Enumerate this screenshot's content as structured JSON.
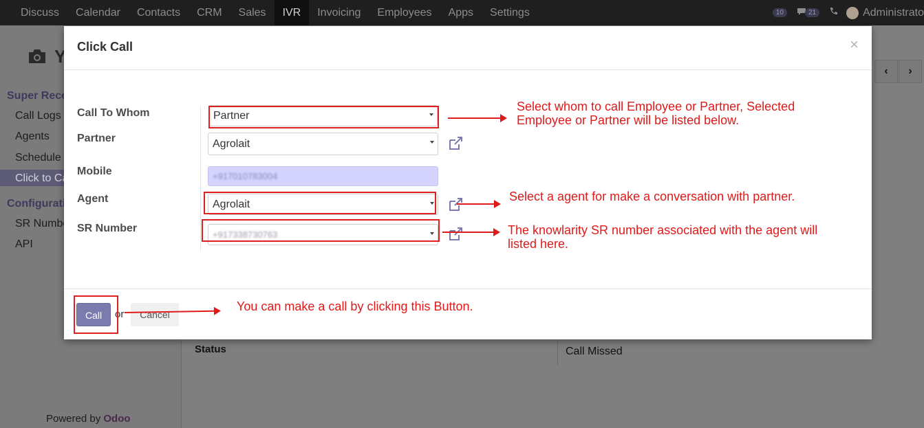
{
  "nav": {
    "items": [
      "Discuss",
      "Calendar",
      "Contacts",
      "CRM",
      "Sales",
      "IVR",
      "Invoicing",
      "Employees",
      "Apps",
      "Settings"
    ],
    "active": "IVR",
    "badge_activity": "10",
    "badge_messages": "21",
    "user": "Administrato"
  },
  "sidebar": {
    "section1": "Super Rece",
    "items1": [
      "Call Logs",
      "Agents",
      "Schedule",
      "Click to Ca"
    ],
    "active_item": "Click to Ca",
    "section2": "Configurati",
    "items2": [
      "SR Number",
      "API"
    ],
    "powered_prefix": "Powered by",
    "powered_brand": "Odoo"
  },
  "background": {
    "breadcrumb_fragment": "Y",
    "status_label": "Status",
    "status_value": "Call Missed"
  },
  "modal": {
    "title": "Click Call",
    "close": "×",
    "fields": {
      "call_to_whom_label": "Call To Whom",
      "call_to_whom_value": "Partner",
      "partner_label": "Partner",
      "partner_value": "Agrolait",
      "mobile_label": "Mobile",
      "mobile_value": "+917010783004",
      "agent_label": "Agent",
      "agent_value": "Agrolait",
      "sr_number_label": "SR Number",
      "sr_number_value": "+917338730763"
    },
    "footer": {
      "call_label": "Call",
      "or_label": "or",
      "cancel_label": "Cancel"
    }
  },
  "annotations": {
    "call_to_whom": "Select whom to call Employee or Partner, Selected Employee or Partner will be listed below.",
    "agent": "Select a agent for make a conversation with partner.",
    "sr_number": "The knowlarity SR number associated with the agent will listed here.",
    "call_button": "You can make a call by clicking this Button."
  },
  "colors": {
    "annotation": "#e01a1a",
    "primary_button": "#7c7bad",
    "mobile_field_bg": "#d4d4ff"
  }
}
